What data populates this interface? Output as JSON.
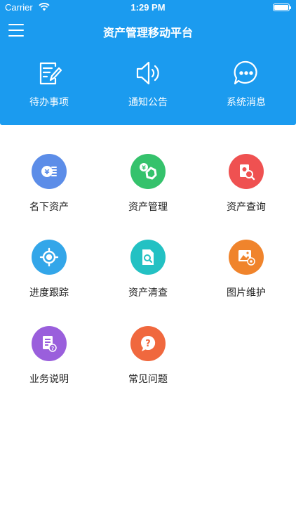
{
  "status_bar": {
    "carrier": "Carrier",
    "time": "1:29 PM",
    "wifi_icon": "wifi-icon",
    "battery_level": 1.0
  },
  "nav": {
    "title": "资产管理移动平台",
    "menu_icon": "hamburger-menu-icon"
  },
  "quick_actions": [
    {
      "label": "待办事项",
      "icon": "todo-edit-icon"
    },
    {
      "label": "通知公告",
      "icon": "speaker-icon"
    },
    {
      "label": "系统消息",
      "icon": "chat-bubble-icon"
    }
  ],
  "grid": [
    {
      "label": "名下资产",
      "icon": "yuan-document-icon",
      "color": "#5c8de8"
    },
    {
      "label": "资产管理",
      "icon": "yuan-gear-icon",
      "color": "#35c26c"
    },
    {
      "label": "资产查询",
      "icon": "search-document-icon",
      "color": "#ef5151"
    },
    {
      "label": "进度跟踪",
      "icon": "target-icon",
      "color": "#33a6e9"
    },
    {
      "label": "资产清查",
      "icon": "document-search-icon",
      "color": "#23c1c3"
    },
    {
      "label": "图片维护",
      "icon": "image-gear-icon",
      "color": "#f0842c"
    },
    {
      "label": "业务说明",
      "icon": "document-question-icon",
      "color": "#9a5fdc"
    },
    {
      "label": "常见问题",
      "icon": "question-icon",
      "color": "#f0683e"
    }
  ],
  "colors": {
    "header_bg": "#1b9bef",
    "page_bg": "#ffffff"
  }
}
